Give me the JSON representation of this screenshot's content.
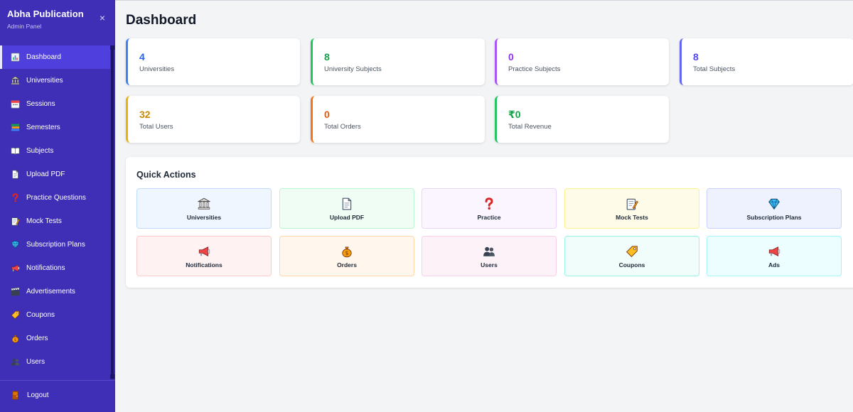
{
  "brand": {
    "title": "Abha Publication",
    "subtitle": "Admin Panel",
    "close_icon": "×"
  },
  "colors": {
    "sidebar_bg": "#3f2fb6",
    "sidebar_active": "#4f3fdc",
    "page_bg": "#f3f4f6"
  },
  "sidebar": {
    "items": [
      {
        "label": "Dashboard",
        "icon": "chart-icon",
        "active": true
      },
      {
        "label": "Universities",
        "icon": "bank-icon"
      },
      {
        "label": "Sessions",
        "icon": "calendar-icon"
      },
      {
        "label": "Semesters",
        "icon": "books-icon"
      },
      {
        "label": "Subjects",
        "icon": "book-icon"
      },
      {
        "label": "Upload PDF",
        "icon": "document-icon"
      },
      {
        "label": "Practice Questions",
        "icon": "question-icon"
      },
      {
        "label": "Mock Tests",
        "icon": "memo-icon"
      },
      {
        "label": "Subscription Plans",
        "icon": "gem-icon"
      },
      {
        "label": "Notifications",
        "icon": "megaphone-icon"
      },
      {
        "label": "Advertisements",
        "icon": "clapper-icon"
      },
      {
        "label": "Coupons",
        "icon": "tag-icon"
      },
      {
        "label": "Orders",
        "icon": "money-bag-icon"
      },
      {
        "label": "Users",
        "icon": "users-icon"
      }
    ],
    "logout": {
      "label": "Logout",
      "icon": "door-icon"
    }
  },
  "page": {
    "title": "Dashboard"
  },
  "stats": [
    {
      "value": "4",
      "label": "Universities",
      "color": "#3b82f6",
      "value_color": "#2563eb"
    },
    {
      "value": "8",
      "label": "University Subjects",
      "color": "#22c55e",
      "value_color": "#16a34a"
    },
    {
      "value": "0",
      "label": "Practice Subjects",
      "color": "#a855f7",
      "value_color": "#9333ea"
    },
    {
      "value": "8",
      "label": "Total Subjects",
      "color": "#6366f1",
      "value_color": "#4f46e5"
    },
    {
      "value": "32",
      "label": "Total Users",
      "color": "#eab308",
      "value_color": "#ca8a04"
    },
    {
      "value": "0",
      "label": "Total Orders",
      "color": "#f97316",
      "value_color": "#ea580c"
    },
    {
      "value": "₹0",
      "label": "Total Revenue",
      "color": "#22c55e",
      "value_color": "#16a34a"
    }
  ],
  "quick_actions": {
    "title": "Quick Actions",
    "items": [
      {
        "label": "Universities",
        "icon": "bank-icon",
        "bg": "#eff6ff",
        "border": "#bfdbfe"
      },
      {
        "label": "Upload PDF",
        "icon": "document-icon",
        "bg": "#f0fdf4",
        "border": "#bbf7d0"
      },
      {
        "label": "Practice",
        "icon": "question-icon",
        "bg": "#faf5ff",
        "border": "#e9d5ff"
      },
      {
        "label": "Mock Tests",
        "icon": "memo-icon",
        "bg": "#fefce8",
        "border": "#fef08a"
      },
      {
        "label": "Subscription Plans",
        "icon": "gem-icon",
        "bg": "#eef2ff",
        "border": "#c7d2fe"
      },
      {
        "label": "Notifications",
        "icon": "megaphone-icon",
        "bg": "#fef2f2",
        "border": "#fecaca"
      },
      {
        "label": "Orders",
        "icon": "money-bag-icon",
        "bg": "#fff7ed",
        "border": "#fed7aa"
      },
      {
        "label": "Users",
        "icon": "users-icon",
        "bg": "#fdf2f8",
        "border": "#fbcfe8"
      },
      {
        "label": "Coupons",
        "icon": "tag-icon",
        "bg": "#f0fdfa",
        "border": "#99f6e4"
      },
      {
        "label": "Ads",
        "icon": "megaphone-icon",
        "bg": "#ecfeff",
        "border": "#a5f3fc"
      }
    ]
  }
}
